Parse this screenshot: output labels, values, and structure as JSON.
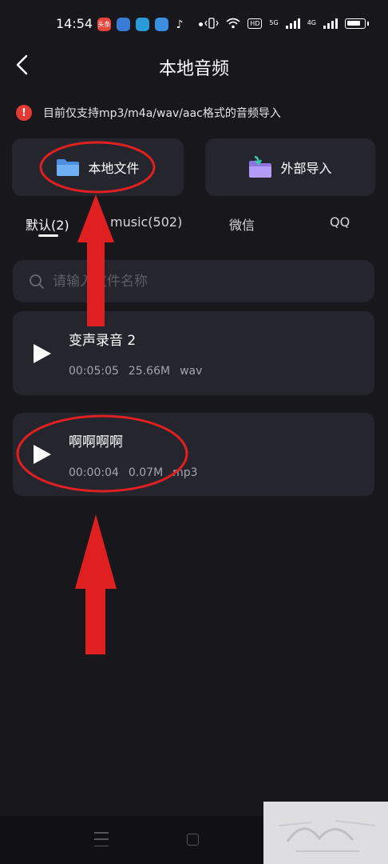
{
  "status_bar": {
    "time": "14:54",
    "app_badge": "头条",
    "net_labels": [
      "HD",
      "5G",
      "4G"
    ]
  },
  "header": {
    "title": "本地音频"
  },
  "notice": {
    "icon": "exclamation-icon",
    "text": "目前仅支持mp3/m4a/wav/aac格式的音频导入"
  },
  "import_buttons": [
    {
      "label": "本地文件",
      "icon": "folder-icon"
    },
    {
      "label": "外部导入",
      "icon": "folder-import-icon"
    }
  ],
  "tabs": [
    {
      "label": "默认(2)",
      "active": true
    },
    {
      "label": "music(502)",
      "active": false
    },
    {
      "label": "微信",
      "active": false
    },
    {
      "label": "QQ",
      "active": false
    }
  ],
  "search": {
    "placeholder": "请输入文件名称"
  },
  "files": [
    {
      "name": "变声录音 2",
      "duration": "00:05:05",
      "size": "25.66M",
      "format": "wav"
    },
    {
      "name": "啊啊啊啊",
      "duration": "00:00:04",
      "size": "0.07M",
      "format": "mp3"
    }
  ],
  "colors": {
    "background": "#17171c",
    "card": "#25252e",
    "annotation": "#e02020",
    "folder_blue": "#5aa3f0",
    "folder_purple": "#a88cf5",
    "notice_red": "#e53935"
  }
}
